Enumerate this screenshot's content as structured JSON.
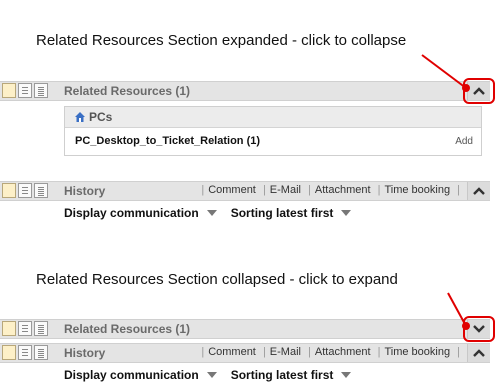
{
  "annotations": {
    "expanded": "Related Resources Section expanded - click to collapse",
    "collapsed": "Related Resources Section collapsed - click to expand"
  },
  "related_resources": {
    "title": "Related Resources (1)",
    "group_label": "PCs",
    "relation_label": "PC_Desktop_to_Ticket_Relation (1)",
    "add_label": "Add"
  },
  "history": {
    "title": "History",
    "actions": [
      "Comment",
      "E-Mail",
      "Attachment",
      "Time booking"
    ],
    "filter_display": "Display communication",
    "filter_sort": "Sorting latest first"
  },
  "icons": {
    "view_toggles": [
      "view-form-icon",
      "view-list-icon",
      "view-detail-icon"
    ],
    "collapse": "chevron-up-icon",
    "expand": "chevron-down-icon",
    "group": "home-icon"
  },
  "colors": {
    "callout": "#e00000"
  }
}
